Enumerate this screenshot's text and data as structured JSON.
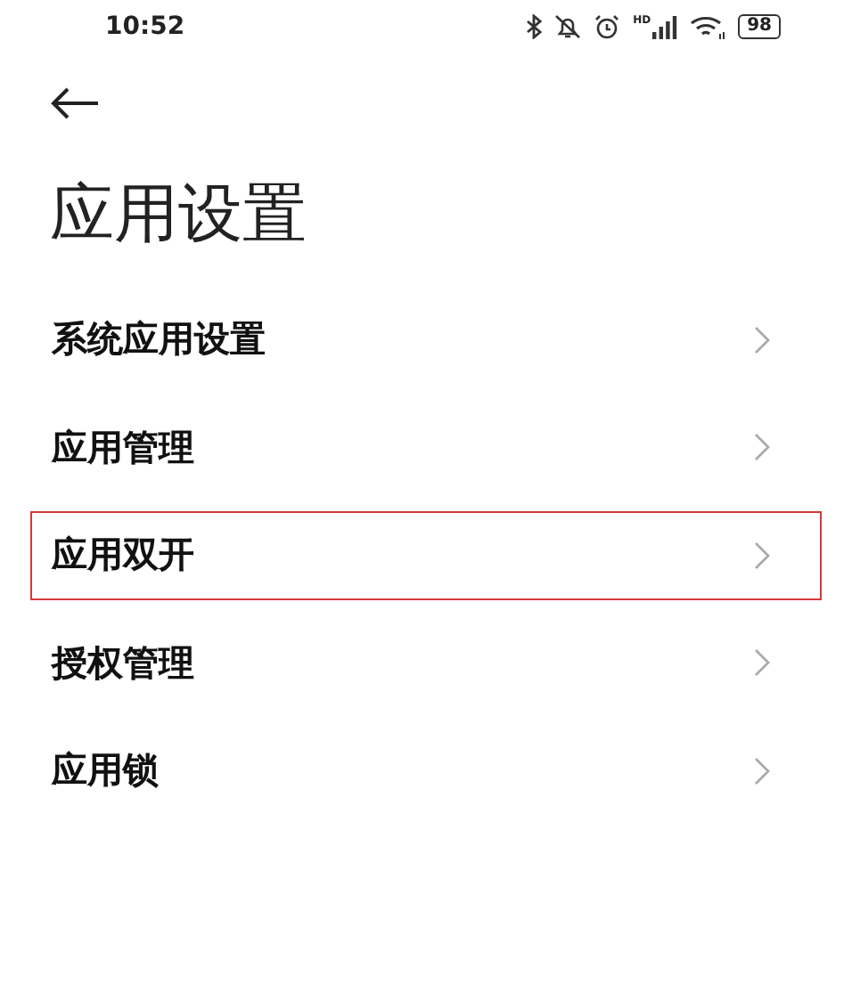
{
  "status_bar": {
    "time": "10:52",
    "network_label": "HD",
    "battery": "98"
  },
  "header": {
    "title": "应用设置"
  },
  "items": [
    {
      "label": "系统应用设置",
      "highlighted": false
    },
    {
      "label": "应用管理",
      "highlighted": false
    },
    {
      "label": "应用双开",
      "highlighted": true
    },
    {
      "label": "授权管理",
      "highlighted": false
    },
    {
      "label": "应用锁",
      "highlighted": false
    }
  ]
}
